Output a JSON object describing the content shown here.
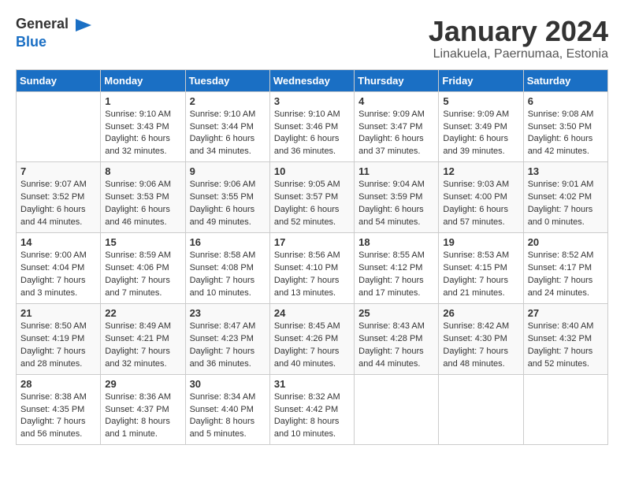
{
  "header": {
    "logo_general": "General",
    "logo_blue": "Blue",
    "month": "January 2024",
    "location": "Linakuela, Paernumaa, Estonia"
  },
  "weekdays": [
    "Sunday",
    "Monday",
    "Tuesday",
    "Wednesday",
    "Thursday",
    "Friday",
    "Saturday"
  ],
  "weeks": [
    [
      {
        "day": "",
        "text": ""
      },
      {
        "day": "1",
        "text": "Sunrise: 9:10 AM\nSunset: 3:43 PM\nDaylight: 6 hours\nand 32 minutes."
      },
      {
        "day": "2",
        "text": "Sunrise: 9:10 AM\nSunset: 3:44 PM\nDaylight: 6 hours\nand 34 minutes."
      },
      {
        "day": "3",
        "text": "Sunrise: 9:10 AM\nSunset: 3:46 PM\nDaylight: 6 hours\nand 36 minutes."
      },
      {
        "day": "4",
        "text": "Sunrise: 9:09 AM\nSunset: 3:47 PM\nDaylight: 6 hours\nand 37 minutes."
      },
      {
        "day": "5",
        "text": "Sunrise: 9:09 AM\nSunset: 3:49 PM\nDaylight: 6 hours\nand 39 minutes."
      },
      {
        "day": "6",
        "text": "Sunrise: 9:08 AM\nSunset: 3:50 PM\nDaylight: 6 hours\nand 42 minutes."
      }
    ],
    [
      {
        "day": "7",
        "text": "Sunrise: 9:07 AM\nSunset: 3:52 PM\nDaylight: 6 hours\nand 44 minutes."
      },
      {
        "day": "8",
        "text": "Sunrise: 9:06 AM\nSunset: 3:53 PM\nDaylight: 6 hours\nand 46 minutes."
      },
      {
        "day": "9",
        "text": "Sunrise: 9:06 AM\nSunset: 3:55 PM\nDaylight: 6 hours\nand 49 minutes."
      },
      {
        "day": "10",
        "text": "Sunrise: 9:05 AM\nSunset: 3:57 PM\nDaylight: 6 hours\nand 52 minutes."
      },
      {
        "day": "11",
        "text": "Sunrise: 9:04 AM\nSunset: 3:59 PM\nDaylight: 6 hours\nand 54 minutes."
      },
      {
        "day": "12",
        "text": "Sunrise: 9:03 AM\nSunset: 4:00 PM\nDaylight: 6 hours\nand 57 minutes."
      },
      {
        "day": "13",
        "text": "Sunrise: 9:01 AM\nSunset: 4:02 PM\nDaylight: 7 hours\nand 0 minutes."
      }
    ],
    [
      {
        "day": "14",
        "text": "Sunrise: 9:00 AM\nSunset: 4:04 PM\nDaylight: 7 hours\nand 3 minutes."
      },
      {
        "day": "15",
        "text": "Sunrise: 8:59 AM\nSunset: 4:06 PM\nDaylight: 7 hours\nand 7 minutes."
      },
      {
        "day": "16",
        "text": "Sunrise: 8:58 AM\nSunset: 4:08 PM\nDaylight: 7 hours\nand 10 minutes."
      },
      {
        "day": "17",
        "text": "Sunrise: 8:56 AM\nSunset: 4:10 PM\nDaylight: 7 hours\nand 13 minutes."
      },
      {
        "day": "18",
        "text": "Sunrise: 8:55 AM\nSunset: 4:12 PM\nDaylight: 7 hours\nand 17 minutes."
      },
      {
        "day": "19",
        "text": "Sunrise: 8:53 AM\nSunset: 4:15 PM\nDaylight: 7 hours\nand 21 minutes."
      },
      {
        "day": "20",
        "text": "Sunrise: 8:52 AM\nSunset: 4:17 PM\nDaylight: 7 hours\nand 24 minutes."
      }
    ],
    [
      {
        "day": "21",
        "text": "Sunrise: 8:50 AM\nSunset: 4:19 PM\nDaylight: 7 hours\nand 28 minutes."
      },
      {
        "day": "22",
        "text": "Sunrise: 8:49 AM\nSunset: 4:21 PM\nDaylight: 7 hours\nand 32 minutes."
      },
      {
        "day": "23",
        "text": "Sunrise: 8:47 AM\nSunset: 4:23 PM\nDaylight: 7 hours\nand 36 minutes."
      },
      {
        "day": "24",
        "text": "Sunrise: 8:45 AM\nSunset: 4:26 PM\nDaylight: 7 hours\nand 40 minutes."
      },
      {
        "day": "25",
        "text": "Sunrise: 8:43 AM\nSunset: 4:28 PM\nDaylight: 7 hours\nand 44 minutes."
      },
      {
        "day": "26",
        "text": "Sunrise: 8:42 AM\nSunset: 4:30 PM\nDaylight: 7 hours\nand 48 minutes."
      },
      {
        "day": "27",
        "text": "Sunrise: 8:40 AM\nSunset: 4:32 PM\nDaylight: 7 hours\nand 52 minutes."
      }
    ],
    [
      {
        "day": "28",
        "text": "Sunrise: 8:38 AM\nSunset: 4:35 PM\nDaylight: 7 hours\nand 56 minutes."
      },
      {
        "day": "29",
        "text": "Sunrise: 8:36 AM\nSunset: 4:37 PM\nDaylight: 8 hours\nand 1 minute."
      },
      {
        "day": "30",
        "text": "Sunrise: 8:34 AM\nSunset: 4:40 PM\nDaylight: 8 hours\nand 5 minutes."
      },
      {
        "day": "31",
        "text": "Sunrise: 8:32 AM\nSunset: 4:42 PM\nDaylight: 8 hours\nand 10 minutes."
      },
      {
        "day": "",
        "text": ""
      },
      {
        "day": "",
        "text": ""
      },
      {
        "day": "",
        "text": ""
      }
    ]
  ]
}
